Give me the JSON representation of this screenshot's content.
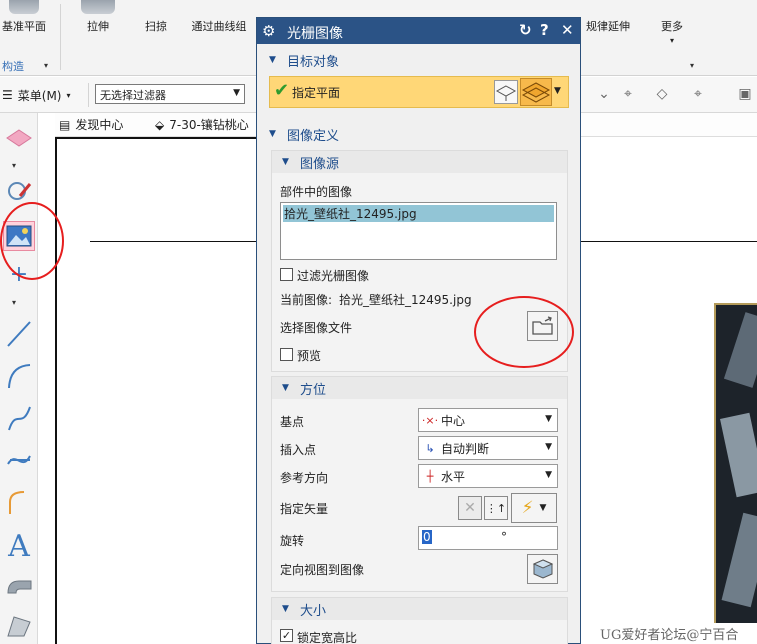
{
  "ribbon": {
    "buttons": [
      {
        "label": "基准平面"
      },
      {
        "label": "拉伸"
      },
      {
        "label": "扫掠"
      },
      {
        "label": "通过曲线组"
      },
      {
        "label": "规律延伸"
      },
      {
        "label": "更多"
      }
    ],
    "group_caption": "构造"
  },
  "cmdbar": {
    "menu_label": "菜单(M)",
    "filter_value": "无选择过滤器"
  },
  "tabs": [
    {
      "label": "发现中心"
    },
    {
      "label": "7-30-镶钻桃心"
    }
  ],
  "dialog": {
    "title": "光栅图像",
    "target": {
      "heading": "目标对象",
      "specify_plane": "指定平面"
    },
    "image_def": {
      "heading": "图像定义",
      "source": {
        "heading": "图像源",
        "images_in_part_label": "部件中的图像",
        "images": [
          "拾光_壁纸社_12495.jpg"
        ],
        "filter_label": "过滤光栅图像",
        "filter_checked": false,
        "current_label": "当前图像:",
        "current_value": "拾光_壁纸社_12495.jpg",
        "select_file_label": "选择图像文件",
        "preview_label": "预览",
        "preview_checked": false
      },
      "orientation": {
        "heading": "方位",
        "base_point_label": "基点",
        "base_point_value": "中心",
        "insert_point_label": "插入点",
        "insert_point_value": "自动判断",
        "ref_dir_label": "参考方向",
        "ref_dir_value": "水平",
        "vector_label": "指定矢量",
        "rotate_label": "旋转",
        "rotate_value": "0",
        "rotate_unit": "°",
        "orient_view_label": "定向视图到图像"
      },
      "size": {
        "heading": "大小",
        "lock_ratio_label": "锁定宽高比",
        "lock_ratio_checked": true
      }
    }
  },
  "watermark": "UG爱好者论坛@宁百合",
  "colors": {
    "title_bar": "#2b5386",
    "selection_highlight": "#ffd777",
    "annotation_red": "#e61e1e",
    "list_selected": "#92c5d6"
  }
}
